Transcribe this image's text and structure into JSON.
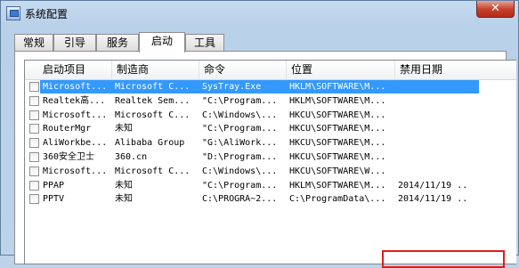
{
  "window": {
    "title": "系统配置",
    "close_glyph": "✕"
  },
  "tabs": [
    {
      "label": "常规"
    },
    {
      "label": "引导"
    },
    {
      "label": "服务"
    },
    {
      "label": "启动"
    },
    {
      "label": "工具"
    }
  ],
  "active_tab": "启动",
  "table": {
    "columns": [
      "启动项目",
      "制造商",
      "命令",
      "位置",
      "禁用日期"
    ],
    "rows": [
      {
        "item": "Microsoft...",
        "maker": "Microsoft C...",
        "command": "SysTray.Exe",
        "location": "HKLM\\SOFTWARE\\M...",
        "date": "",
        "selected": true
      },
      {
        "item": "Realtek高...",
        "maker": "Realtek Sem...",
        "command": "\"C:\\Program...",
        "location": "HKLM\\SOFTWARE\\M...",
        "date": "",
        "selected": false
      },
      {
        "item": "Microsoft...",
        "maker": "Microsoft C...",
        "command": "C:\\Windows\\...",
        "location": "HKCU\\SOFTWARE\\M...",
        "date": "",
        "selected": false
      },
      {
        "item": "RouterMgr",
        "maker": "未知",
        "command": "\"C:\\Program...",
        "location": "HKCU\\SOFTWARE\\M...",
        "date": "",
        "selected": false
      },
      {
        "item": "AliWorkbe...",
        "maker": "Alibaba Group",
        "command": "\"G:\\AliWork...",
        "location": "HKCU\\SOFTWARE\\M...",
        "date": "",
        "selected": false
      },
      {
        "item": "360安全卫士",
        "maker": "360.cn",
        "command": "\"D:\\Program...",
        "location": "HKCU\\SOFTWARE\\M...",
        "date": "",
        "selected": false
      },
      {
        "item": "Microsoft...",
        "maker": "Microsoft C...",
        "command": "C:\\Windows\\...",
        "location": "HKCU\\SOFTWARE\\W...",
        "date": "",
        "selected": false
      },
      {
        "item": "PPAP",
        "maker": "未知",
        "command": "\"C:\\Program...",
        "location": "HKLM\\SOFTWARE\\M...",
        "date": "2014/11/19 ...",
        "selected": false
      },
      {
        "item": "PPTV",
        "maker": "未知",
        "command": "C:\\PROGRA~2...",
        "location": "C:\\ProgramData\\...",
        "date": "2014/11/19 ...",
        "selected": false
      }
    ]
  },
  "colors": {
    "selection": "#3399ff",
    "highlight_box": "#e11b1b"
  }
}
